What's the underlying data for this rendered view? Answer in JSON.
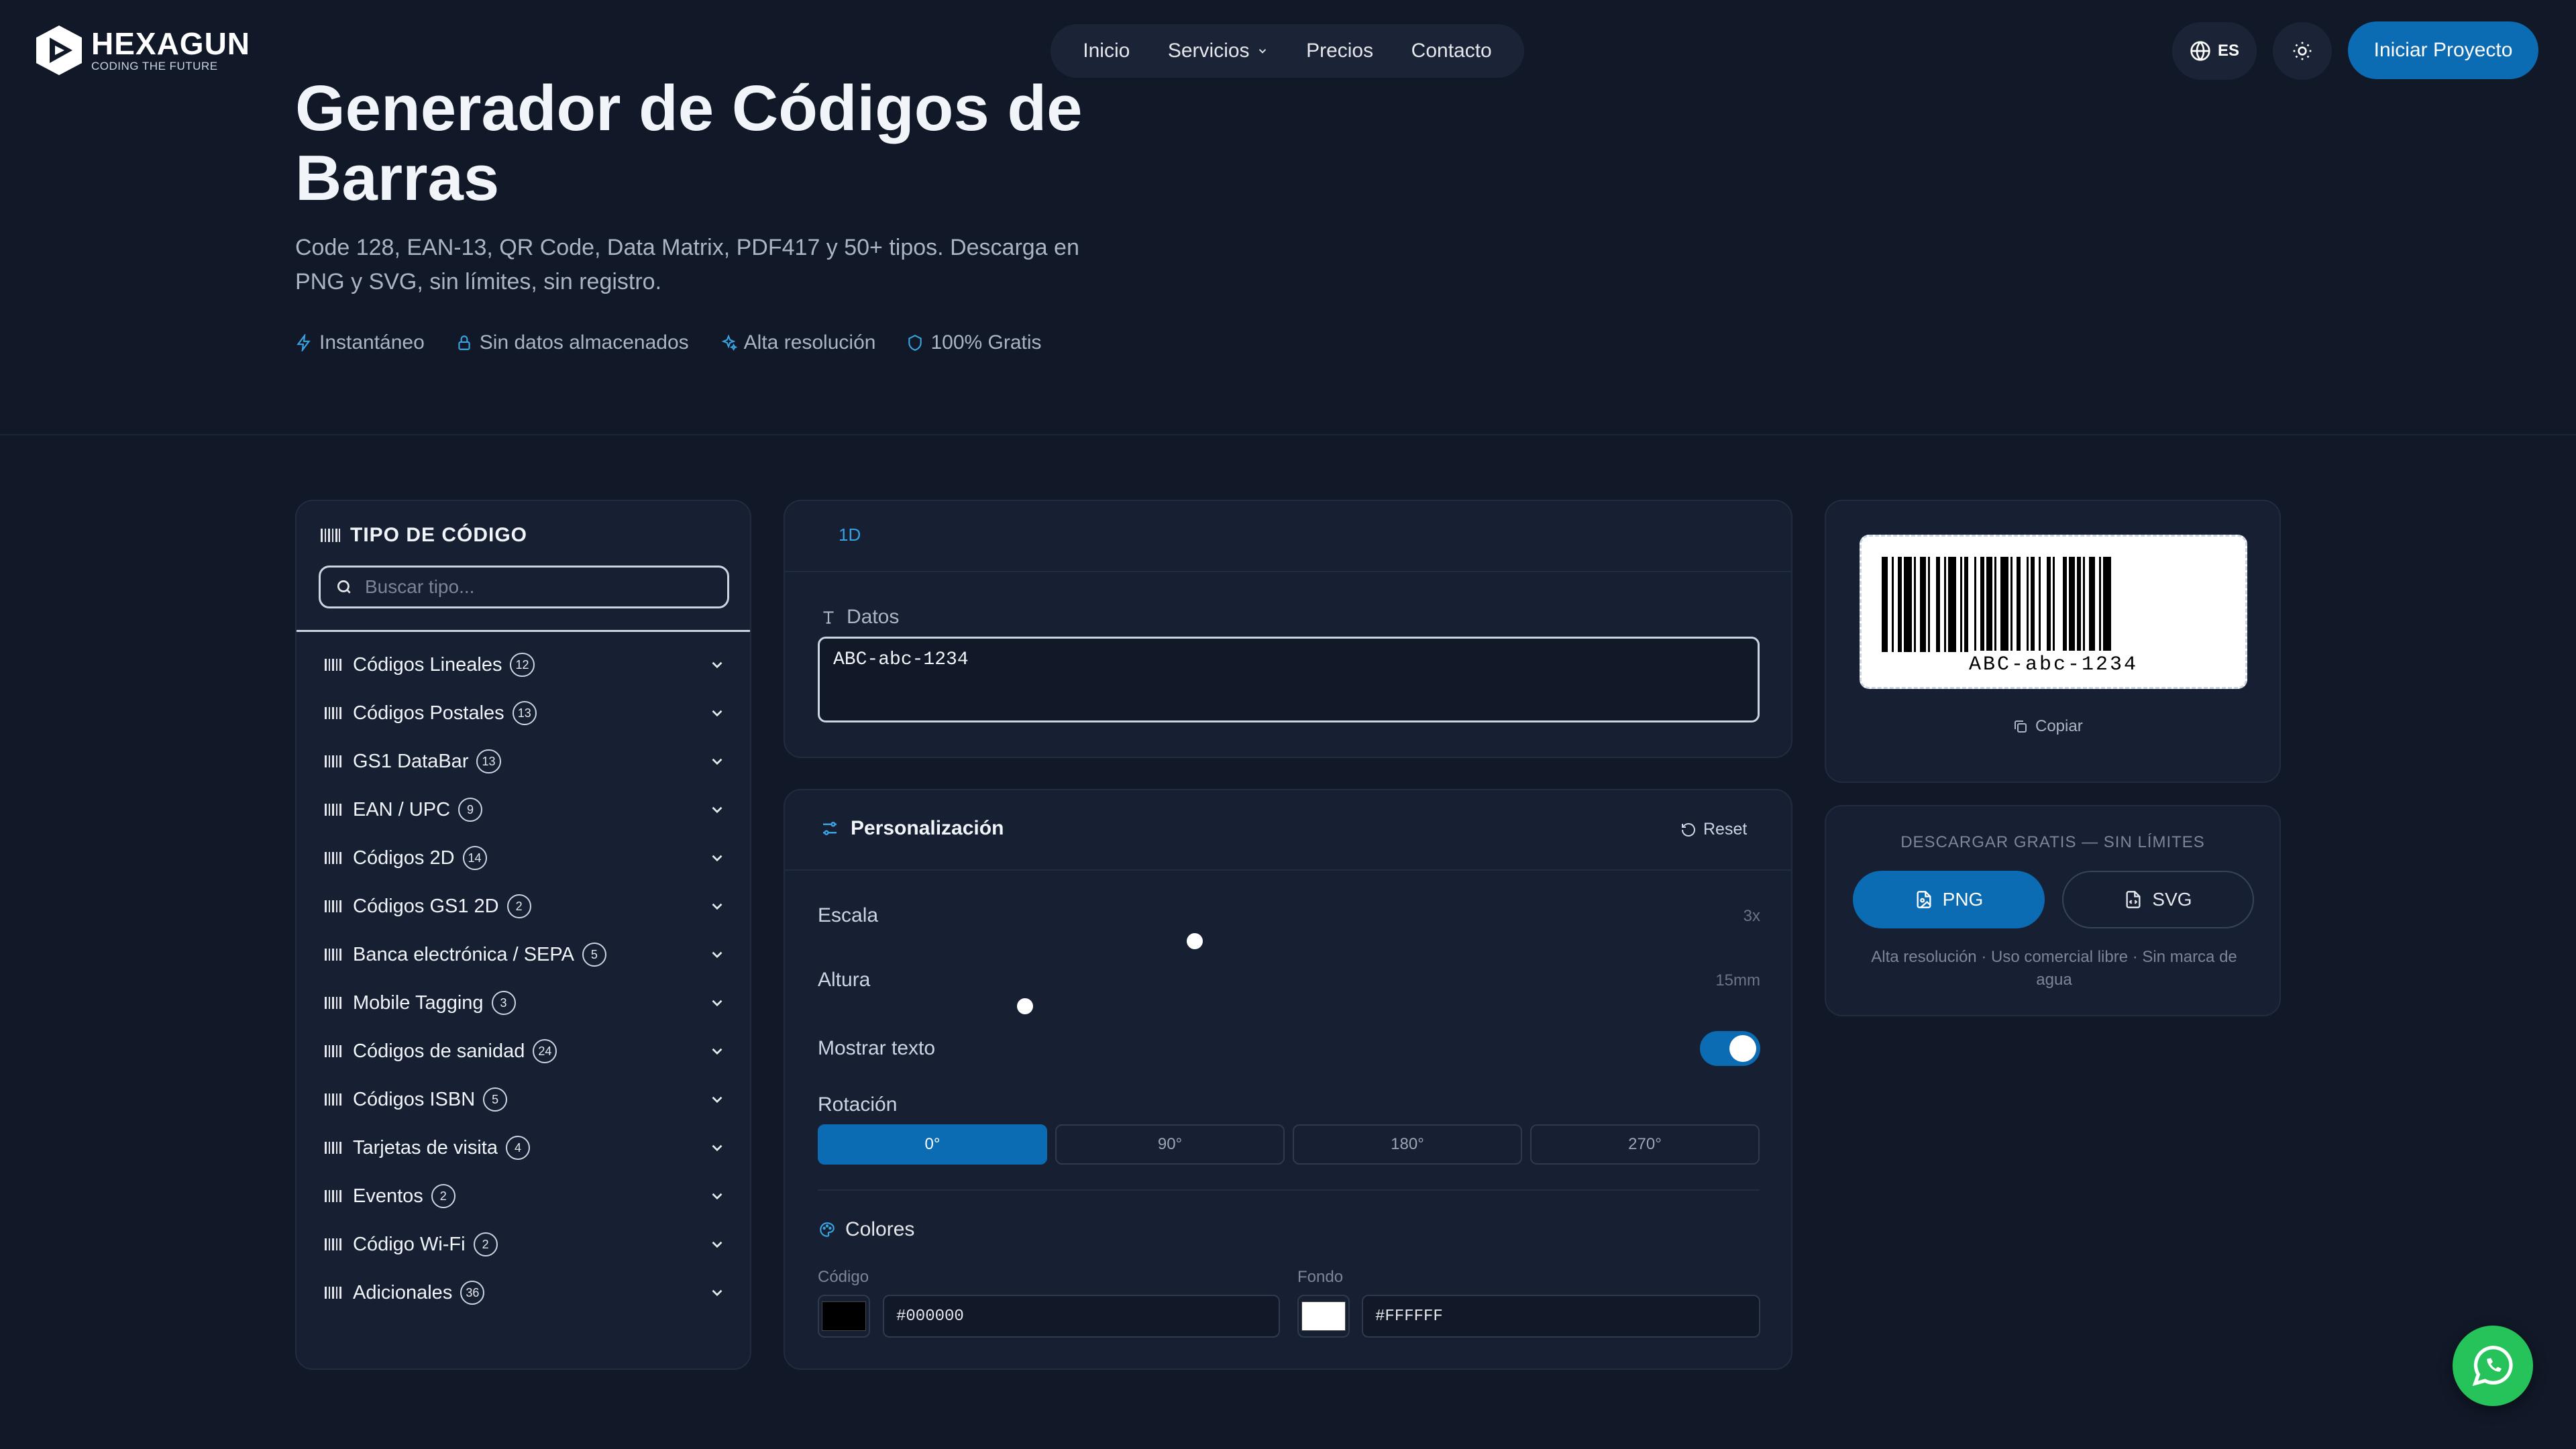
{
  "brand": {
    "name": "HEXAGUN",
    "tagline": "CODING THE FUTURE"
  },
  "nav": {
    "items": [
      "Inicio",
      "Servicios",
      "Precios",
      "Contacto"
    ]
  },
  "header": {
    "lang": "ES",
    "cta": "Iniciar Proyecto"
  },
  "hero": {
    "title": "Generador de Códigos de Barras",
    "subtitle": "Code 128, EAN-13, QR Code, Data Matrix, PDF417 y 50+ tipos. Descarga en PNG y SVG, sin límites, sin registro.",
    "features": [
      "Instantáneo",
      "Sin datos almacenados",
      "Alta resolución",
      "100% Gratis"
    ]
  },
  "sidebar": {
    "title": "TIPO DE CÓDIGO",
    "search_placeholder": "Buscar tipo...",
    "categories": [
      {
        "name": "Códigos Lineales",
        "count": "12"
      },
      {
        "name": "Códigos Postales",
        "count": "13"
      },
      {
        "name": "GS1 DataBar",
        "count": "13"
      },
      {
        "name": "EAN / UPC",
        "count": "9"
      },
      {
        "name": "Códigos 2D",
        "count": "14"
      },
      {
        "name": "Códigos GS1 2D",
        "count": "2"
      },
      {
        "name": "Banca electrónica / SEPA",
        "count": "5"
      },
      {
        "name": "Mobile Tagging",
        "count": "3"
      },
      {
        "name": "Códigos de sanidad",
        "count": "24"
      },
      {
        "name": "Códigos ISBN",
        "count": "5"
      },
      {
        "name": "Tarjetas de visita",
        "count": "4"
      },
      {
        "name": "Eventos",
        "count": "2"
      },
      {
        "name": "Código Wi-Fi",
        "count": "2"
      },
      {
        "name": "Adicionales",
        "count": "36"
      }
    ]
  },
  "editor": {
    "tab": "1D",
    "datos_label": "Datos",
    "datos_value": "ABC-abc-1234"
  },
  "personalizacion": {
    "title": "Personalización",
    "reset": "Reset",
    "escala_label": "Escala",
    "escala_value": "3x",
    "escala_level": 0.4,
    "altura_label": "Altura",
    "altura_value": "15mm",
    "altura_level": 0.22,
    "mostrar_texto_label": "Mostrar texto",
    "mostrar_texto_on": true,
    "rotacion_label": "Rotación",
    "rotaciones": [
      "0°",
      "90°",
      "180°",
      "270°"
    ],
    "rotacion_selected": "0°",
    "colores_title": "Colores",
    "codigo_label": "Código",
    "codigo_hex": "#000000",
    "fondo_label": "Fondo",
    "fondo_hex": "#FFFFFF"
  },
  "preview": {
    "barcode_text": "ABC-abc-1234",
    "copy": "Copiar"
  },
  "download": {
    "title": "DESCARGAR GRATIS — SIN LÍMITES",
    "png": "PNG",
    "svg": "SVG",
    "note": "Alta resolución · Uso comercial libre · Sin marca de agua"
  },
  "colors": {
    "background": "#111827",
    "panel": "#172033",
    "accent": "#0b6bb3",
    "whatsapp": "#25c35a"
  },
  "icons": [
    "logo-icon",
    "chevron-down-icon",
    "globe-icon",
    "sun-icon",
    "bolt-icon",
    "lock-icon",
    "sparkles-icon",
    "shield-icon",
    "barcode-icon",
    "search-icon",
    "text-icon",
    "sliders-icon",
    "reset-icon",
    "palette-icon",
    "copy-icon",
    "file-image-icon",
    "file-code-icon",
    "whatsapp-icon"
  ]
}
